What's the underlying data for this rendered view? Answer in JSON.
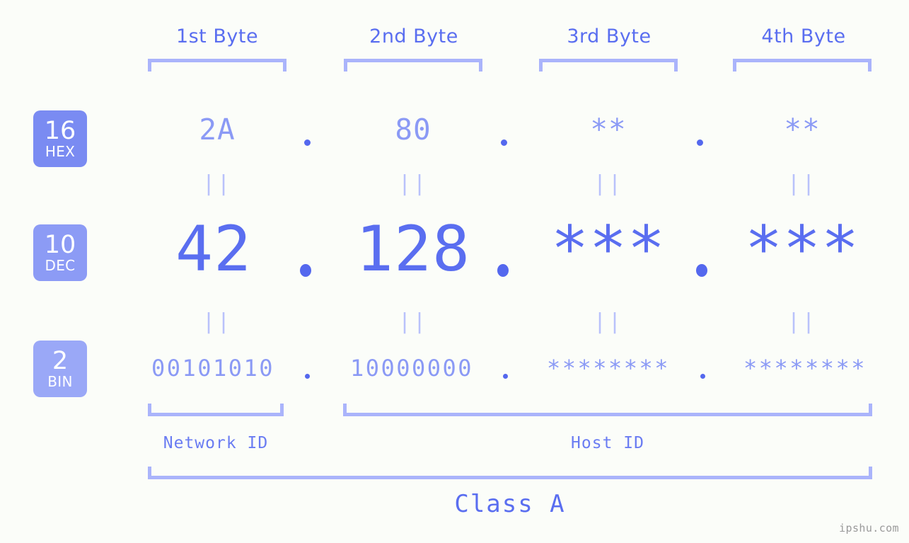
{
  "background_color": "#fbfdf9",
  "accent_color": "#5a6ef0",
  "accent_light_color": "#8b9af5",
  "bracket_color": "#aab4fb",
  "headers": {
    "byte1": "1st Byte",
    "byte2": "2nd Byte",
    "byte3": "3rd Byte",
    "byte4": "4th Byte"
  },
  "bases": [
    {
      "number": "16",
      "name": "HEX",
      "color": "#7a8bf2"
    },
    {
      "number": "10",
      "name": "DEC",
      "color": "#8c9bf5"
    },
    {
      "number": "2",
      "name": "BIN",
      "color": "#9aa8f7"
    }
  ],
  "rows": {
    "hex": {
      "b1": "2A",
      "b2": "80",
      "b3": "**",
      "b4": "**"
    },
    "dec": {
      "b1": "42",
      "b2": "128",
      "b3": "***",
      "b4": "***"
    },
    "bin": {
      "b1": "00101010",
      "b2": "10000000",
      "b3": "********",
      "b4": "********"
    }
  },
  "separators": {
    "dot": ".",
    "equals": "||"
  },
  "captions": {
    "network_id": "Network ID",
    "host_id": "Host ID",
    "ip_class": "Class A"
  },
  "watermark": "ipshu.com"
}
